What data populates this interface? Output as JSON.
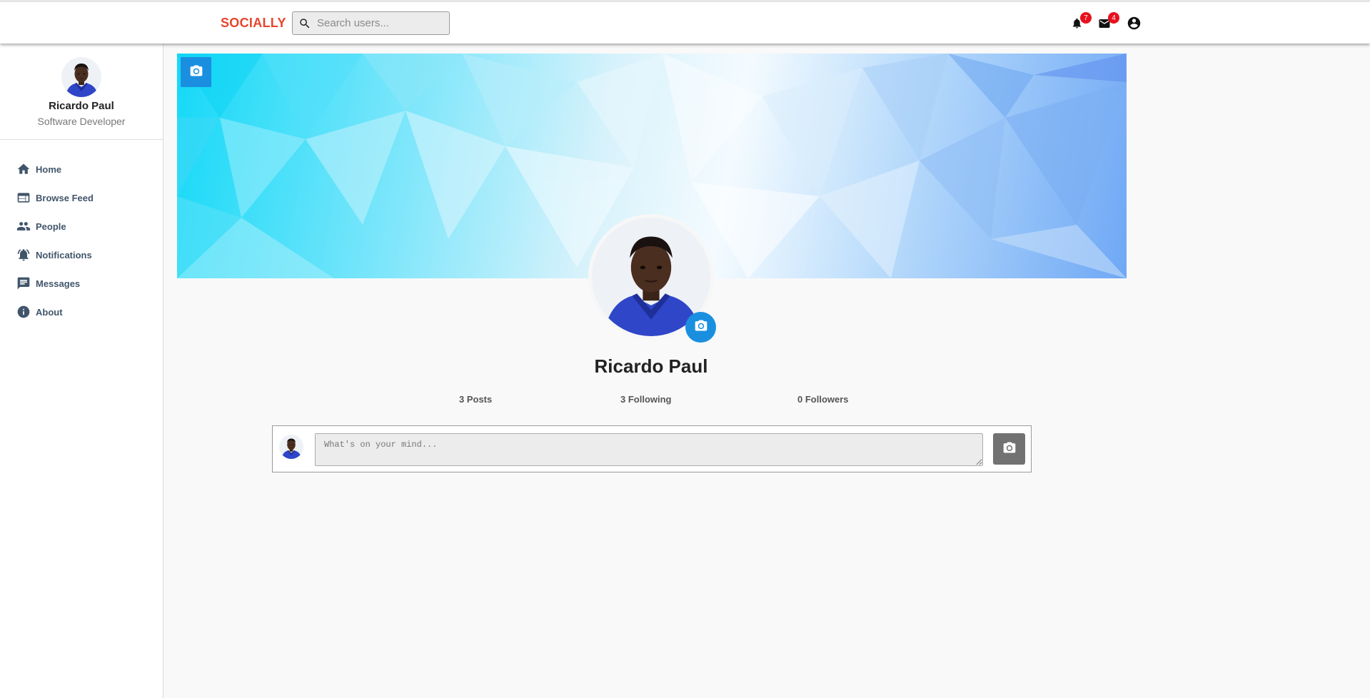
{
  "header": {
    "brand": "SOCIALLY",
    "search_placeholder": "Search users...",
    "notifications_count": "7",
    "messages_count": "4"
  },
  "sidebar": {
    "user_name": "Ricardo Paul",
    "user_role": "Software Developer",
    "items": [
      {
        "label": "Home",
        "icon": "home-icon"
      },
      {
        "label": "Browse Feed",
        "icon": "feed-icon"
      },
      {
        "label": "People",
        "icon": "people-icon"
      },
      {
        "label": "Notifications",
        "icon": "notifications-active-icon"
      },
      {
        "label": "Messages",
        "icon": "chat-icon"
      },
      {
        "label": "About",
        "icon": "info-icon"
      }
    ]
  },
  "profile": {
    "name": "Ricardo Paul",
    "posts": "3 Posts",
    "following": "3 Following",
    "followers": "0 Followers"
  },
  "composer": {
    "placeholder": "What's on your mind..."
  },
  "colors": {
    "brand": "#e8442c",
    "accent": "#1a8fe0",
    "badge": "#e8101c",
    "nav_text": "#41556a"
  }
}
